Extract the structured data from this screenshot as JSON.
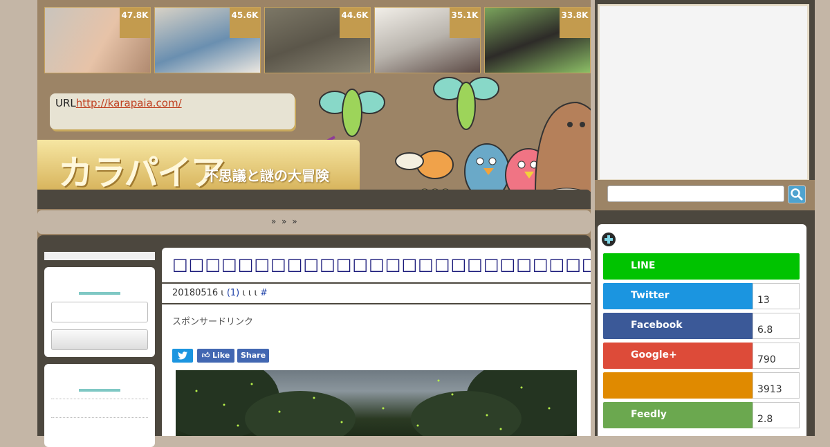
{
  "thumbnails": [
    {
      "count": "47.8K"
    },
    {
      "count": "45.6K"
    },
    {
      "count": "44.6K"
    },
    {
      "count": "35.1K"
    },
    {
      "count": "33.8K"
    }
  ],
  "header": {
    "url_label": "URL",
    "url_link": "http://karapaia.com/",
    "logo_text": "カラパイア",
    "tagline": "不思議と謎の大冒険"
  },
  "breadcrumb": "»  »        »",
  "article": {
    "title": "□□□□□□□□□□□□□□□□□□□□□□□□□□□□□□□□□□□",
    "meta_date": "20180516",
    "meta_sep1": " ι ",
    "meta_count": "(1)",
    "meta_sep2": " ι  ι         ι ",
    "meta_hash": "#",
    "sponsor": "スポンサードリンク",
    "share": {
      "like": "Like",
      "share": "Share"
    }
  },
  "social": [
    {
      "name": "LINE",
      "count": "",
      "color": "#00c300"
    },
    {
      "name": "Twitter",
      "count": "13",
      "color": "#1b95e0"
    },
    {
      "name": "Facebook",
      "count": "6.8",
      "color": "#3b5998"
    },
    {
      "name": "Google+",
      "count": "790",
      "color": "#dd4b39"
    },
    {
      "name": "",
      "count": "3913",
      "color": "#e08a00"
    },
    {
      "name": "Feedly",
      "count": "2.8",
      "color": "#6cc655"
    }
  ]
}
